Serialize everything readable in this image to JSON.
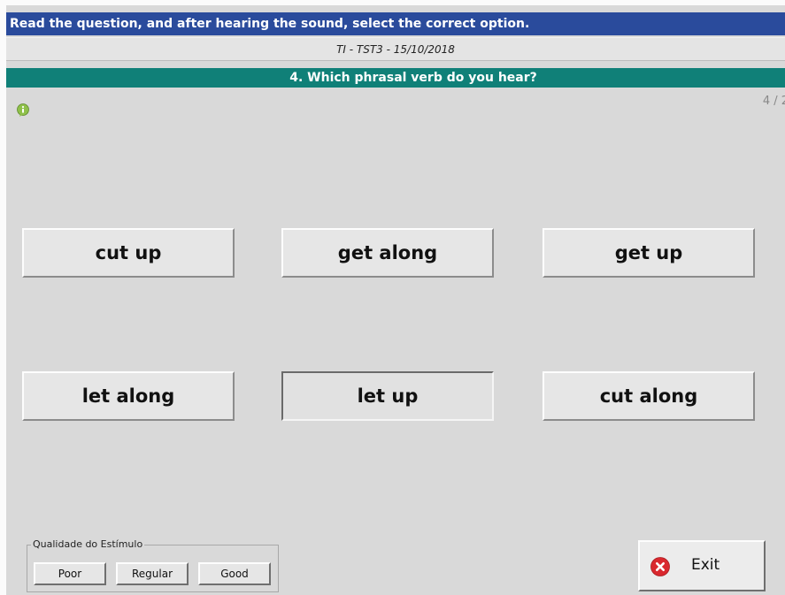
{
  "instruction": "Read the question, and after hearing the sound, select the correct option.",
  "session_label": "TI - TST3 - 15/10/2018",
  "question": "4. Which phrasal verb do you hear?",
  "progress": "4 / 2",
  "options": [
    {
      "label": "cut up",
      "selected": false
    },
    {
      "label": "get along",
      "selected": false
    },
    {
      "label": "get up",
      "selected": false
    },
    {
      "label": "let along",
      "selected": false
    },
    {
      "label": "let up",
      "selected": true
    },
    {
      "label": "cut along",
      "selected": false
    }
  ],
  "quality": {
    "legend": "Qualidade do Estímulo",
    "buttons": [
      "Poor",
      "Regular",
      "Good"
    ]
  },
  "exit_label": "Exit",
  "colors": {
    "instruction_bar": "#2a4b9c",
    "question_bar": "#108078",
    "background": "#d9d9d9",
    "exit_icon": "#d9282e",
    "info_icon": "#8fc04a"
  },
  "icons": {
    "info": "info-bubble-icon",
    "exit": "close-circle-icon"
  }
}
